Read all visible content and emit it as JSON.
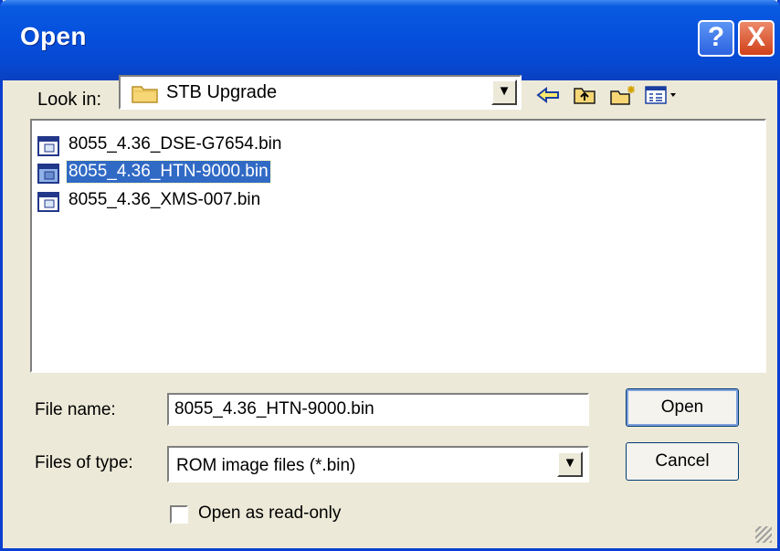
{
  "dialog": {
    "title": "Open",
    "help_glyph": "?",
    "close_glyph": "X"
  },
  "look_in": {
    "label": "Look in:",
    "value": "STB Upgrade",
    "icon": "folder-icon",
    "dropdown_glyph": "▼"
  },
  "toolbar": {
    "back_icon": "back-arrow-icon",
    "up_icon": "up-folder-icon",
    "new_folder_icon": "new-folder-icon",
    "view_menu_icon": "view-menu-icon",
    "back_glyph": "⇦",
    "up_glyph": "⇧",
    "new_glyph": "✱",
    "view_glyph": "▦▾"
  },
  "files": [
    {
      "name": "8055_4.36_DSE-G7654.bin",
      "selected": false
    },
    {
      "name": "8055_4.36_HTN-9000.bin",
      "selected": true
    },
    {
      "name": "8055_4.36_XMS-007.bin",
      "selected": false
    }
  ],
  "file_name": {
    "label": "File name:",
    "value": "8055_4.36_HTN-9000.bin"
  },
  "files_of_type": {
    "label": "Files of type:",
    "value": "ROM image files (*.bin)",
    "dropdown_glyph": "▼"
  },
  "buttons": {
    "open_label": "Open",
    "cancel_label": "Cancel"
  },
  "read_only": {
    "label": "Open as read-only",
    "checked": false
  },
  "colors": {
    "titlebar": "#0550de",
    "selection": "#316ac5",
    "face": "#ece9d8"
  }
}
